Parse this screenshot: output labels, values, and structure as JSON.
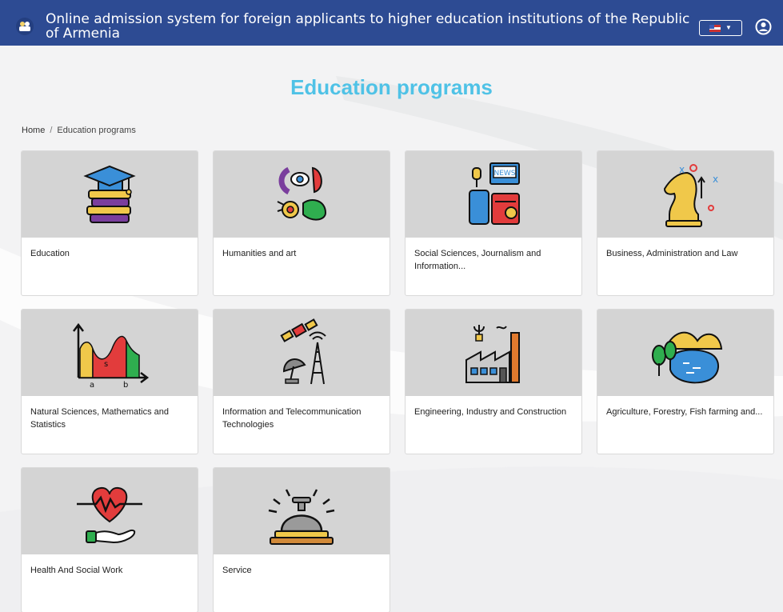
{
  "header": {
    "title": "Online admission system for foreign applicants to higher education institutions of the Republic of Armenia"
  },
  "page": {
    "heading": "Education programs"
  },
  "breadcrumb": {
    "home": "Home",
    "separator": "/",
    "current": "Education programs"
  },
  "programs": [
    {
      "label": "Education",
      "icon": "books-graduation-cap-icon"
    },
    {
      "label": "Humanities and art",
      "icon": "faces-art-icon"
    },
    {
      "label": "Social Sciences, Journalism and Information...",
      "icon": "news-radio-icon"
    },
    {
      "label": "Business, Administration and Law",
      "icon": "chess-knight-strategy-icon"
    },
    {
      "label": "Natural Sciences, Mathematics and Statistics",
      "icon": "graph-curve-icon"
    },
    {
      "label": "Information and Telecommunication Technologies",
      "icon": "satellite-tower-icon"
    },
    {
      "label": "Engineering, Industry and Construction",
      "icon": "factory-icon"
    },
    {
      "label": "Agriculture, Forestry, Fish farming and...",
      "icon": "landscape-lake-trees-icon"
    },
    {
      "label": "Health And Social Work",
      "icon": "heart-hand-icon"
    },
    {
      "label": "Service",
      "icon": "service-bell-icon"
    }
  ],
  "colors": {
    "header_bg": "#2d4b93",
    "heading": "#4fc2e6",
    "card_image_bg": "#d4d4d4",
    "page_bg": "#f3f3f4"
  }
}
